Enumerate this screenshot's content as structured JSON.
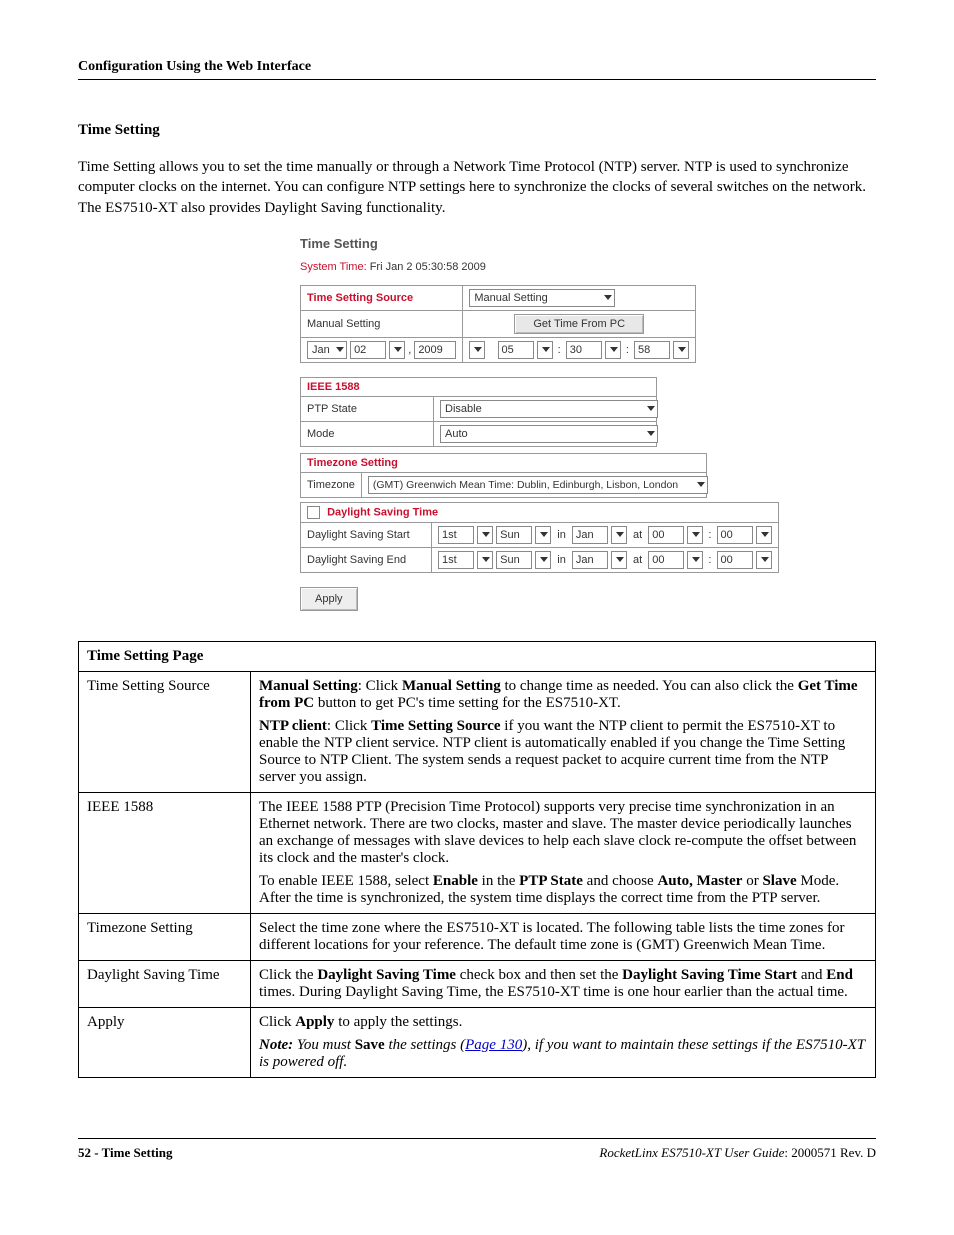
{
  "header": {
    "running": "Configuration Using the Web Interface"
  },
  "section_title": "Time Setting",
  "intro": "Time Setting allows you to set the time manually or through a Network Time Protocol (NTP) server. NTP is used to synchronize computer clocks on the internet. You can configure NTP settings here to synchronize the clocks of several switches on the network. The ES7510-XT also provides Daylight Saving functionality.",
  "ui": {
    "title": "Time Setting",
    "system_time_label": "System Time:",
    "system_time_value": "Fri Jan 2 05:30:58 2009",
    "src_label": "Time Setting Source",
    "src_value": "Manual Setting",
    "manual_label": "Manual Setting",
    "get_time_btn": "Get Time From PC",
    "date_month": "Jan",
    "date_day": "02",
    "date_comma": ",",
    "date_year": "2009",
    "time_hh": "05",
    "time_mm": "30",
    "time_ss": "58",
    "ieee_hdr": "IEEE 1588",
    "ptp_state_label": "PTP State",
    "ptp_state_value": "Disable",
    "mode_label": "Mode",
    "mode_value": "Auto",
    "tz_hdr": "Timezone Setting",
    "tz_label": "Timezone",
    "tz_value": "(GMT) Greenwich Mean Time: Dublin, Edinburgh, Lisbon, London",
    "dst_hdr": "Daylight Saving Time",
    "dst_start_label": "Daylight Saving Start",
    "dst_end_label": "Daylight Saving End",
    "dst_ord": "1st",
    "dst_day": "Sun",
    "dst_in": "in",
    "dst_month": "Jan",
    "dst_at": "at",
    "dst_hh": "00",
    "dst_mm": "00",
    "apply": "Apply"
  },
  "table": {
    "header": "Time Setting Page",
    "rows": {
      "r1_label": "Time Setting Source",
      "r1_p1_a": "Manual Setting",
      "r1_p1_b": ": Click ",
      "r1_p1_c": "Manual Setting",
      "r1_p1_d": " to change time as needed. You can also click the ",
      "r1_p1_e": "Get Time from PC",
      "r1_p1_f": " button to get PC's time setting for the ES7510-XT.",
      "r1_p2_a": "NTP client",
      "r1_p2_b": ": Click ",
      "r1_p2_c": "Time Setting Source",
      "r1_p2_d": " if you want the NTP client to permit the ES7510-XT to enable the NTP client service. NTP client is automatically enabled if you change the Time Setting Source to NTP Client. The system sends a request packet to acquire current time from the NTP server you assign.",
      "r2_label": "IEEE 1588",
      "r2_p1": "The IEEE 1588 PTP (Precision Time Protocol) supports very precise time synchronization in an Ethernet network. There are two clocks, master and slave. The master device periodically launches an exchange of messages with slave devices to help each slave clock re-compute the offset between its clock and the master's clock.",
      "r2_p2_a": "To enable IEEE 1588, select ",
      "r2_p2_b": "Enable",
      "r2_p2_c": " in the ",
      "r2_p2_d": "PTP State",
      "r2_p2_e": " and choose ",
      "r2_p2_f": "Auto, Master",
      "r2_p2_g": " or ",
      "r2_p2_h": "Slave",
      "r2_p2_i": " Mode. After the time is synchronized, the system time displays the correct time from the PTP server.",
      "r3_label": "Timezone Setting",
      "r3_p1": "Select the time zone where the ES7510-XT is located. The following table lists the time zones for different locations for your reference. The default time zone is (GMT) Greenwich Mean Time.",
      "r4_label": "Daylight Saving Time",
      "r4_p1_a": "Click the ",
      "r4_p1_b": "Daylight Saving Time",
      "r4_p1_c": " check box and then set the ",
      "r4_p1_d": "Daylight Saving Time Start",
      "r4_p1_e": " and ",
      "r4_p1_f": "End",
      "r4_p1_g": " times. During Daylight Saving Time, the ES7510-XT time is one hour earlier than the actual time.",
      "r5_label": "Apply",
      "r5_p1_a": "Click ",
      "r5_p1_b": "Apply",
      "r5_p1_c": " to apply the settings.",
      "r5_note_label": "Note:",
      "r5_note_a": "You must ",
      "r5_note_b": "Save",
      "r5_note_c": " the settings (",
      "r5_note_link": "Page 130",
      "r5_note_d": "), if you want to maintain these settings if the ES7510-XT is powered off."
    }
  },
  "footer": {
    "left_a": "52 - Time Setting",
    "right_product": "RocketLinx ES7510-XT  User Guide",
    "right_rev": ": 2000571 Rev. D"
  }
}
